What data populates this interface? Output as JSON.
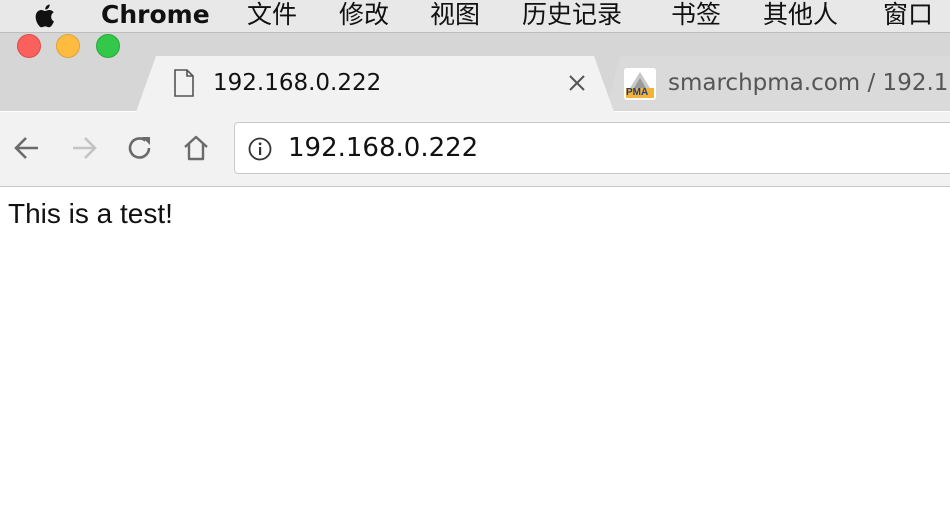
{
  "menubar": {
    "app_name": "Chrome",
    "items": [
      "文件",
      "修改",
      "视图",
      "历史记录",
      "书签",
      "其他人",
      "窗口"
    ]
  },
  "tabs": [
    {
      "title": "192.168.0.222",
      "icon": "page-icon",
      "active": true
    },
    {
      "title": "smarchpma.com / 192.1",
      "icon": "pma-favicon",
      "active": false
    }
  ],
  "toolbar": {
    "address": "192.168.0.222"
  },
  "page": {
    "text": "This is a test!"
  },
  "colors": {
    "close": "#fc605c",
    "minimize": "#fdbc40",
    "zoom": "#34c84a"
  }
}
